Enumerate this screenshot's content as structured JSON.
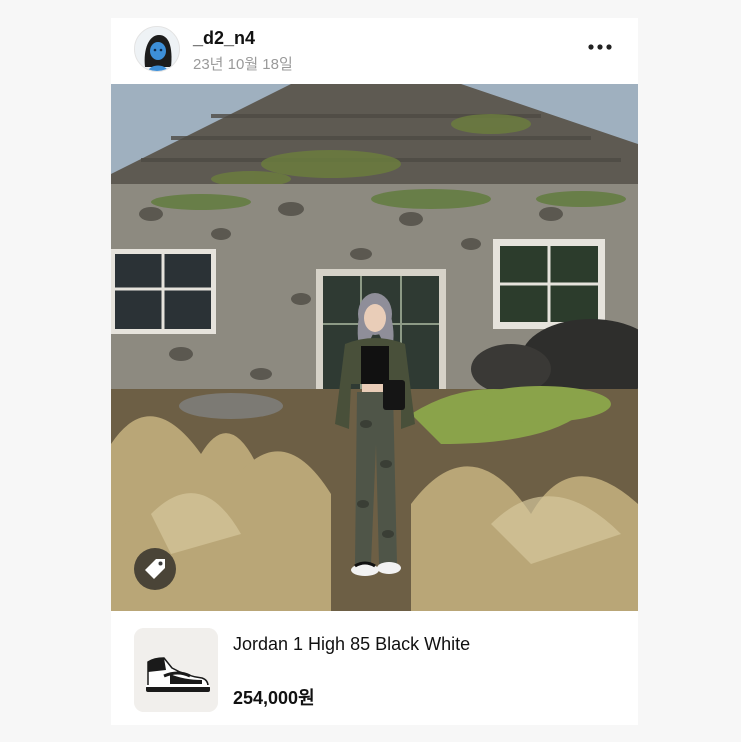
{
  "post": {
    "username": "_d2_n4",
    "date": "23년 10월 18일"
  },
  "icons": {
    "more": "more-dots-icon",
    "tag": "price-tag-icon"
  },
  "product": {
    "name": "Jordan 1 High 85 Black White",
    "price": "254,000원"
  }
}
